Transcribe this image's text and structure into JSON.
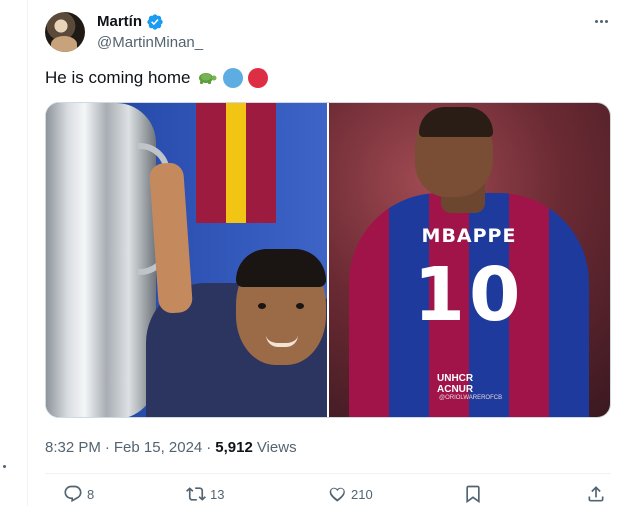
{
  "author": {
    "display_name": "Martín",
    "handle": "@MartinMinan_"
  },
  "tweet": {
    "text": "He is coming home"
  },
  "media": {
    "jersey_name": "MBAPPE",
    "jersey_number": "10",
    "sponsor_line1": "UNHCR",
    "sponsor_line2": "ACNUR",
    "watermark": "@ORIOLWAREROFCB"
  },
  "meta": {
    "time": "8:32 PM",
    "separator": "·",
    "date": "Feb 15, 2024",
    "views_count": "5,912",
    "views_label": "Views"
  },
  "actions": {
    "replies": "8",
    "reposts": "13",
    "likes": "210"
  },
  "colors": {
    "verified": "#1d9bf0",
    "secondary_text": "#536471",
    "circle_blue": "#5dade2",
    "circle_red": "#dd2e44"
  }
}
